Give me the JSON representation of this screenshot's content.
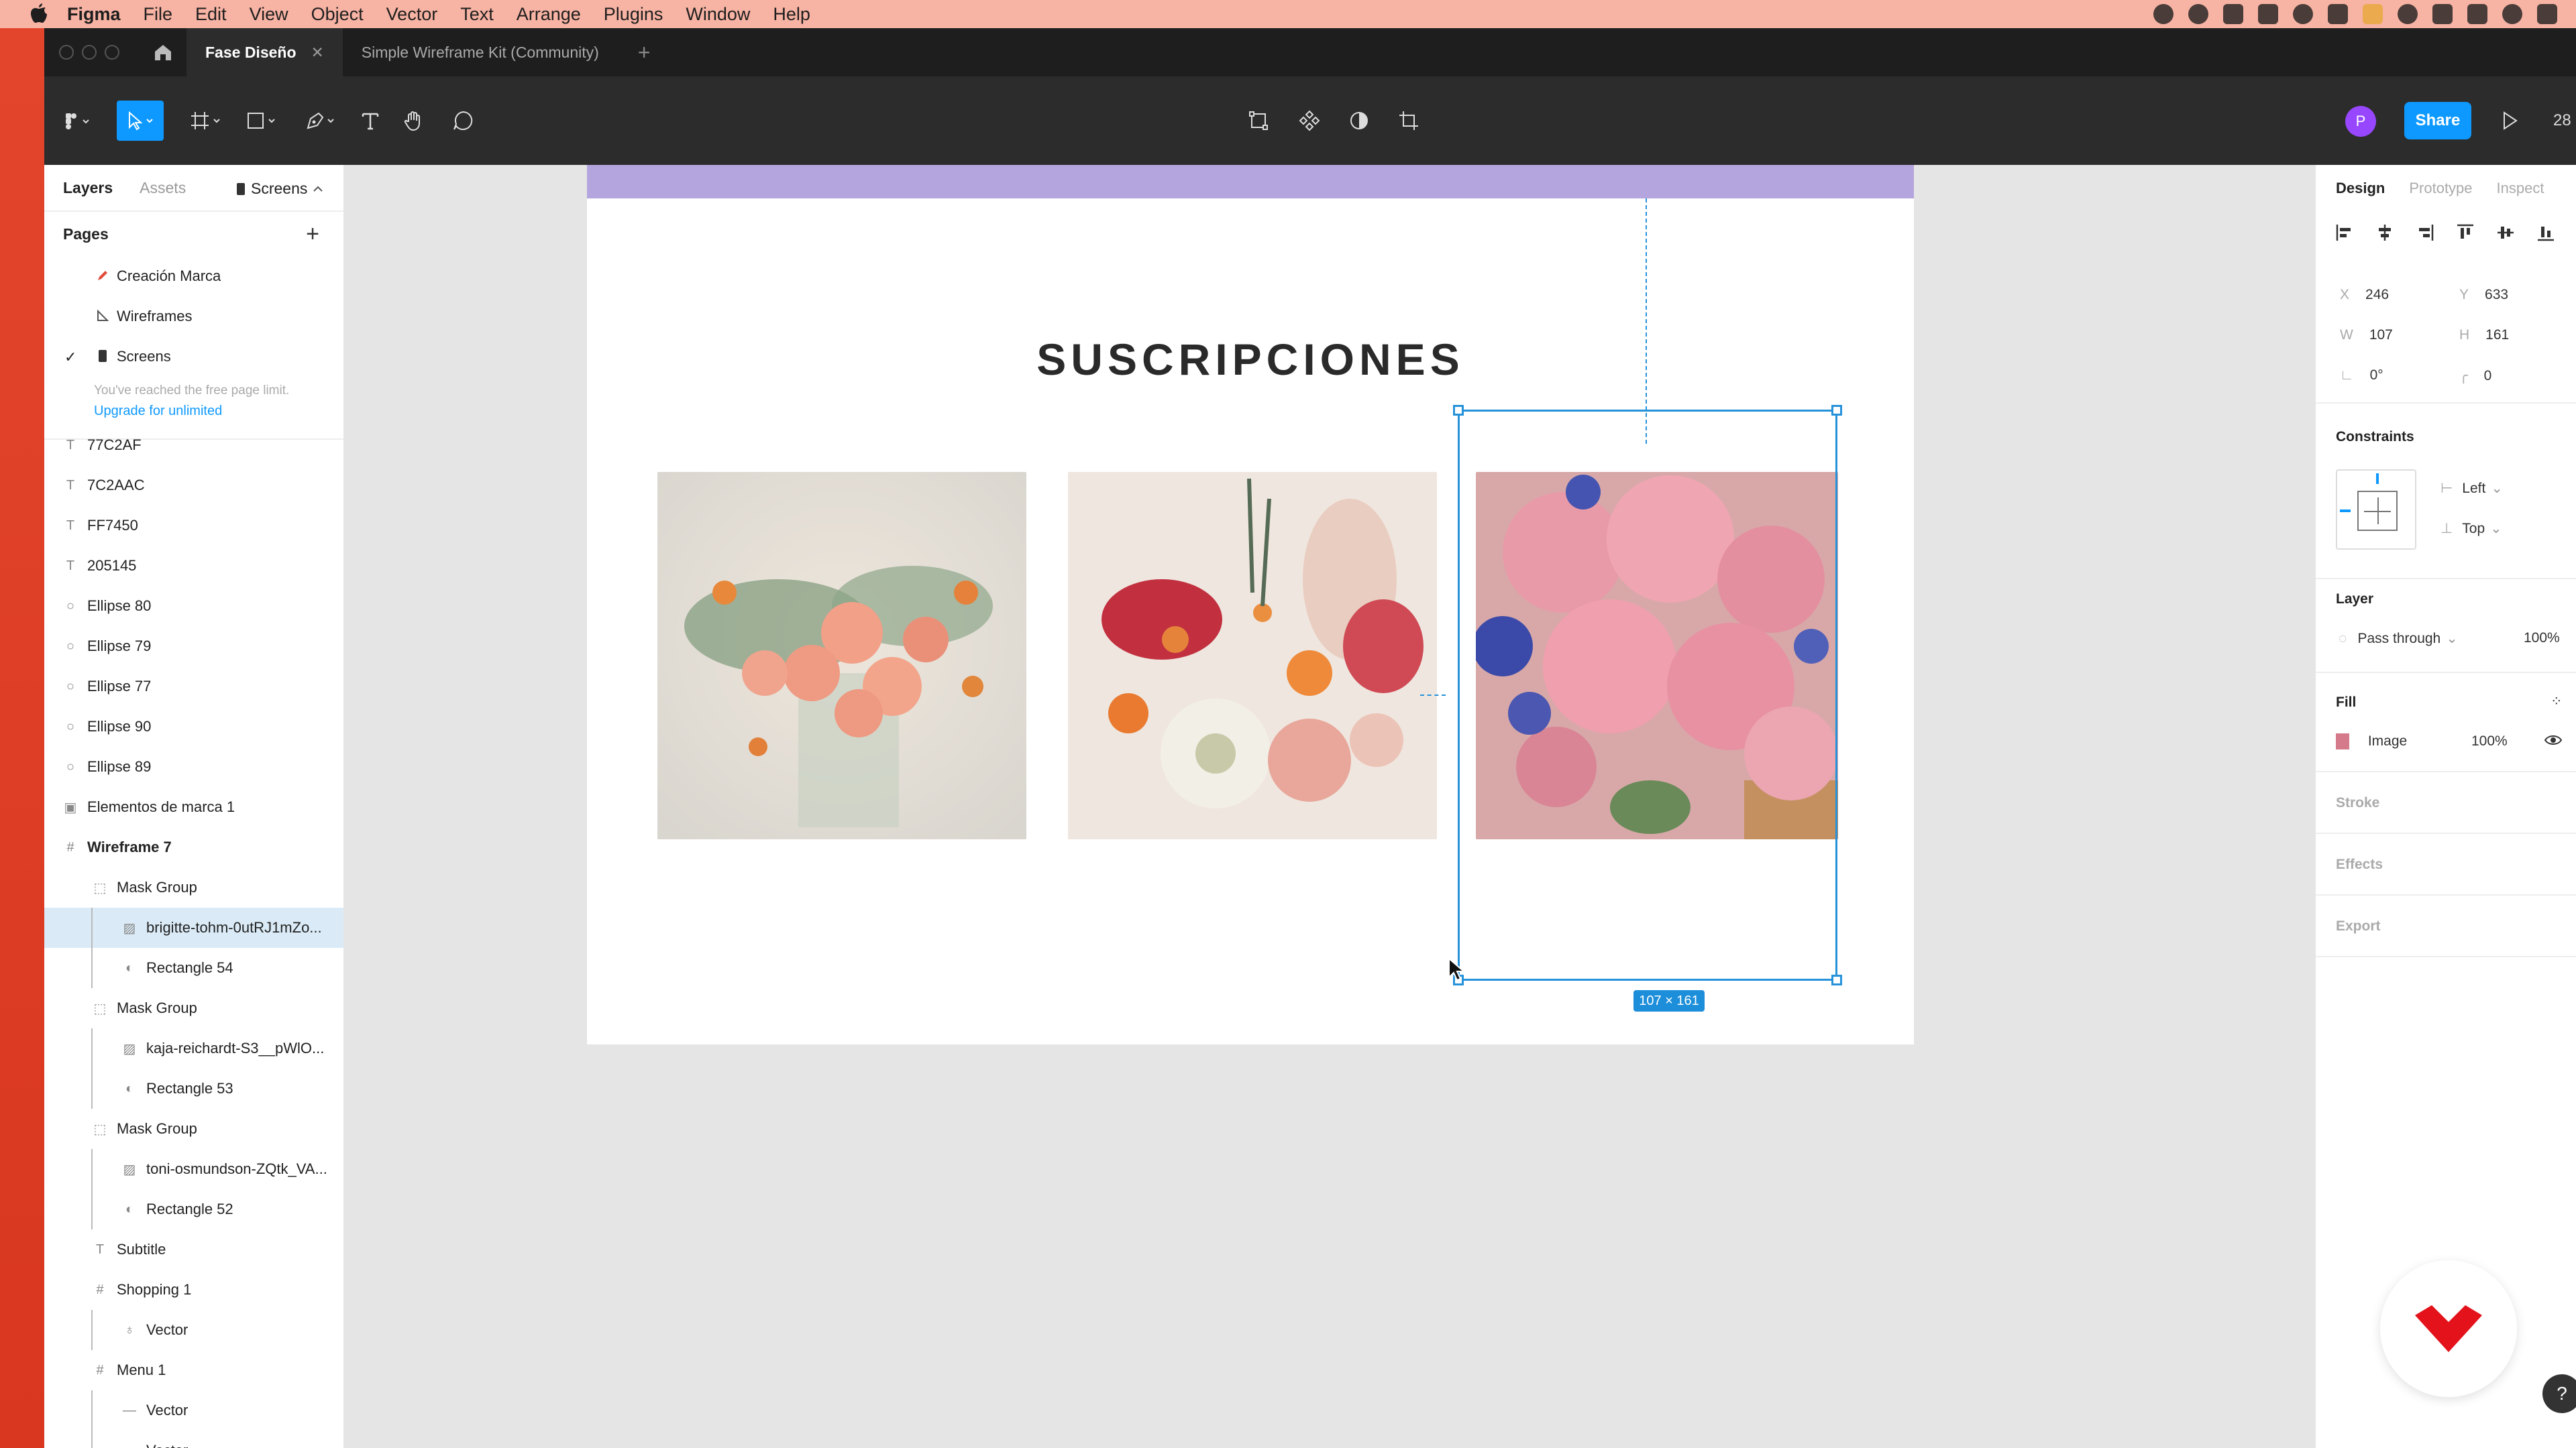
{
  "menubar": {
    "app": "Figma",
    "items": [
      "File",
      "Edit",
      "View",
      "Object",
      "Vector",
      "Text",
      "Arrange",
      "Plugins",
      "Window",
      "Help"
    ]
  },
  "tabs": {
    "active": "Fase Diseño",
    "inactive": "Simple Wireframe Kit (Community)",
    "close": "✕",
    "add": "+"
  },
  "toolbar": {
    "share": "Share",
    "avatar_initial": "P",
    "zoom": "28",
    "icons": [
      "figma-menu-icon",
      "move-tool-icon",
      "frame-tool-icon",
      "shape-tool-icon",
      "pen-tool-icon",
      "text-tool-icon",
      "hand-tool-icon",
      "comment-tool-icon",
      "edit-object-icon",
      "component-icon",
      "mask-icon",
      "crop-icon"
    ]
  },
  "left_panel": {
    "tabs": [
      "Layers",
      "Assets"
    ],
    "page_selector": "Screens",
    "pages_heading": "Pages",
    "pages": [
      "Creación Marca",
      "Wireframes",
      "Screens"
    ],
    "limit_note": "You've reached the free page limit.",
    "upgrade": "Upgrade for unlimited",
    "layers": [
      {
        "label": "77C2AF",
        "icon": "T"
      },
      {
        "label": "7C2AAC",
        "icon": "T"
      },
      {
        "label": "FF7450",
        "icon": "T"
      },
      {
        "label": "205145",
        "icon": "T"
      },
      {
        "label": "Ellipse 80",
        "icon": "○"
      },
      {
        "label": "Ellipse 79",
        "icon": "○"
      },
      {
        "label": "Ellipse 77",
        "icon": "○"
      },
      {
        "label": "Ellipse 90",
        "icon": "○"
      },
      {
        "label": "Ellipse 89",
        "icon": "○"
      },
      {
        "label": "Elementos de marca 1",
        "icon": "▣"
      },
      {
        "label": "Wireframe 7",
        "icon": "#"
      },
      {
        "label": "Mask Group",
        "icon": "⬚"
      },
      {
        "label": "brigitte-tohm-0utRJ1mZo...",
        "icon": "▨"
      },
      {
        "label": "Rectangle 54",
        "icon": "◐"
      },
      {
        "label": "Mask Group",
        "icon": "⬚"
      },
      {
        "label": "kaja-reichardt-S3__pWlO...",
        "icon": "▨"
      },
      {
        "label": "Rectangle 53",
        "icon": "◐"
      },
      {
        "label": "Mask Group",
        "icon": "⬚"
      },
      {
        "label": "toni-osmundson-ZQtk_VA...",
        "icon": "▨"
      },
      {
        "label": "Rectangle 52",
        "icon": "◐"
      },
      {
        "label": "Subtitle",
        "icon": "T"
      },
      {
        "label": "Shopping 1",
        "icon": "#"
      },
      {
        "label": "Vector",
        "icon": "♁"
      },
      {
        "label": "Menu 1",
        "icon": "#"
      },
      {
        "label": "Vector",
        "icon": "—"
      },
      {
        "label": "Vector",
        "icon": "—"
      }
    ]
  },
  "canvas": {
    "title": "SUSCRIPCIONES",
    "size_tag": "107 × 161"
  },
  "right_panel": {
    "tabs": [
      "Design",
      "Prototype",
      "Inspect"
    ],
    "x_label": "X",
    "x": "246",
    "y_label": "Y",
    "y": "633",
    "w_label": "W",
    "w": "107",
    "h_label": "H",
    "h": "161",
    "rotation": "0°",
    "radius": "0",
    "constraints_heading": "Constraints",
    "constraint_h": "Left",
    "constraint_v": "Top",
    "layer_heading": "Layer",
    "blend": "Pass through",
    "opacity": "100%",
    "fill_heading": "Fill",
    "fill_type": "Image",
    "fill_opacity": "100%",
    "stroke_heading": "Stroke",
    "effects_heading": "Effects",
    "export_heading": "Export"
  },
  "help": "?",
  "colors": {
    "accent": "#0d99ff",
    "menubar": "#f7b3a3",
    "banner": "#b5a5de",
    "selection": "#2592da"
  }
}
